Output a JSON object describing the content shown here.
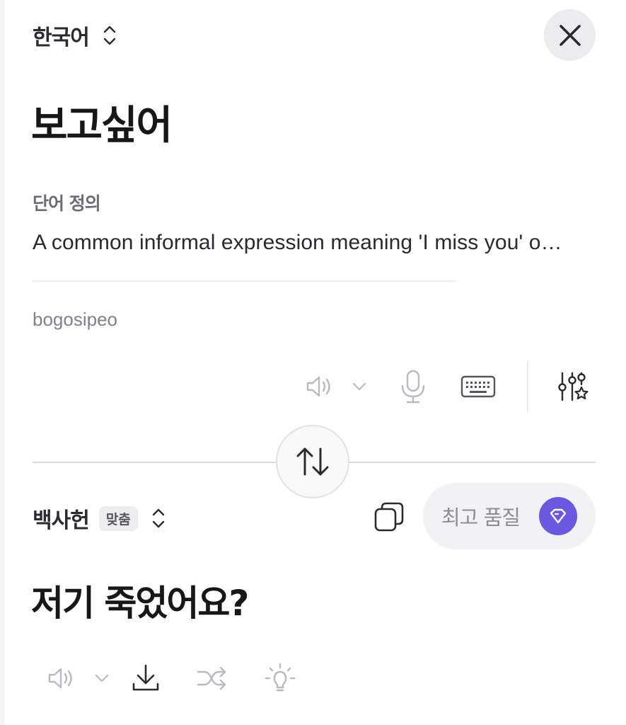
{
  "source": {
    "language": "한국어",
    "text": "보고싶어",
    "definition_title": "단어 정의",
    "definition": "A common informal expression meaning 'I miss you' o…",
    "romanization": "bogosipeo",
    "toolbar_icons": [
      "speaker-icon",
      "chevron-down-icon",
      "microphone-icon",
      "keyboard-icon",
      "sliders-star-icon"
    ]
  },
  "close_icon": "close-icon",
  "swap_icon": "swap-arrows-icon",
  "target": {
    "language": "백사헌",
    "badge": "맞춤",
    "text": "저기 죽었어요?",
    "quality_label": "최고 품질",
    "toolbar_icons": [
      "speaker-icon",
      "chevron-down-icon",
      "download-icon",
      "shuffle-icon",
      "lightbulb-icon"
    ]
  },
  "colors": {
    "accent": "#6b57e0",
    "text": "#17171a",
    "muted": "#808087",
    "icon": "#b9b9bf"
  }
}
